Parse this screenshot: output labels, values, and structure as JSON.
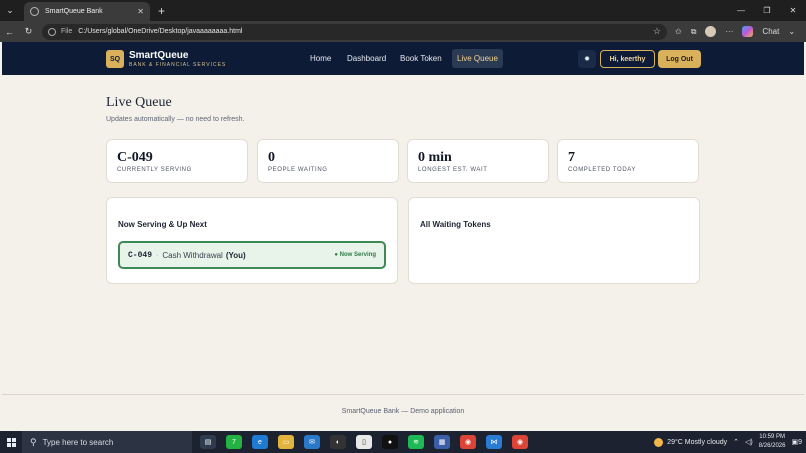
{
  "browser": {
    "tab_title": "SmartQueue Bank",
    "close_glyph": "✕",
    "new_tab_glyph": "+",
    "file_label": "File",
    "url": "C:/Users/global/OneDrive/Desktop/javaaaaaaaa.html",
    "chat_label": "Chat"
  },
  "header": {
    "logo_text": "SQ",
    "brand_name": "SmartQueue",
    "brand_sub": "BANK & FINANCIAL SERVICES",
    "nav": {
      "home": "Home",
      "dashboard": "Dashboard",
      "book_token": "Book Token",
      "live_queue": "Live Queue"
    },
    "greeting": "Hi, keerthy",
    "logout": "Log Out"
  },
  "main": {
    "title": "Live Queue",
    "subtitle": "Updates automatically — no need to refresh.",
    "stats": [
      {
        "value": "C-049",
        "label": "CURRENTLY SERVING"
      },
      {
        "value": "0",
        "label": "PEOPLE WAITING"
      },
      {
        "value": "0 min",
        "label": "LONGEST EST. WAIT"
      },
      {
        "value": "7",
        "label": "COMPLETED TODAY"
      }
    ],
    "serving_panel": {
      "title": "Now Serving & Up Next",
      "row": {
        "token": "C-049",
        "separator": "·",
        "service": "Cash Withdrawal",
        "you": "(You)",
        "status": "● Now Serving"
      }
    },
    "waiting_panel": {
      "title": "All Waiting Tokens"
    }
  },
  "footer": {
    "text": "SmartQueue Bank — Demo application"
  },
  "taskbar": {
    "search_placeholder": "Type here to search",
    "whatsapp_badge": "7",
    "weather": "29°C  Mostly cloudy",
    "time": "10:59 PM",
    "date": "8/26/2026",
    "notif_count": "9"
  }
}
